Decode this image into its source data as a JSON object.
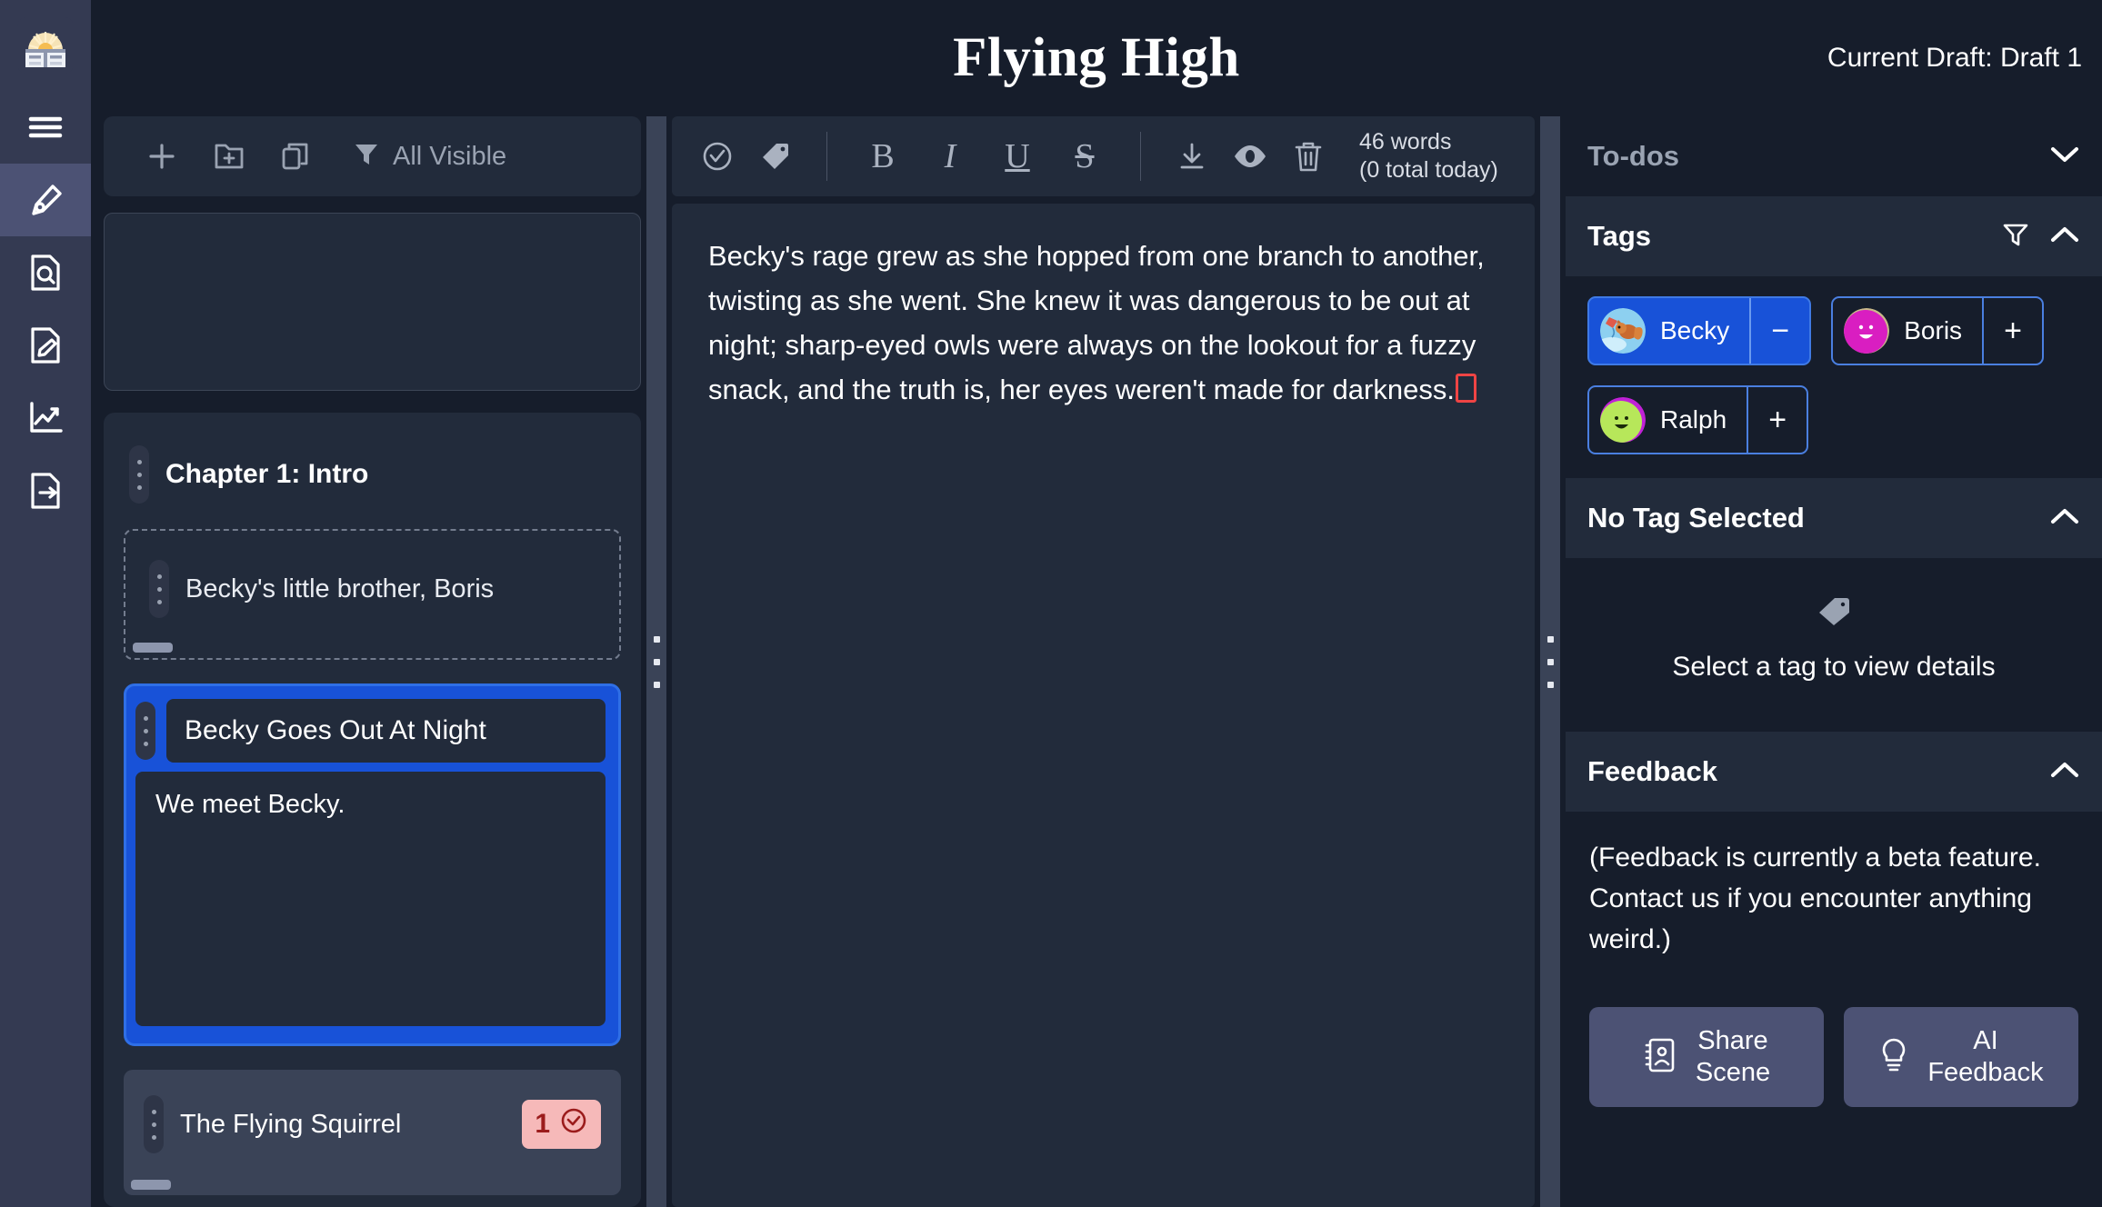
{
  "header": {
    "app_title": "Flying High",
    "draft_label": "Current Draft: Draft 1",
    "logo_icon": "sunrise-window-logo"
  },
  "rail": {
    "items": [
      {
        "icon": "hamburger-menu-icon",
        "name": "menu",
        "active": false
      },
      {
        "icon": "pen-nib-icon",
        "name": "write",
        "active": true
      },
      {
        "icon": "document-search-icon",
        "name": "research",
        "active": false
      },
      {
        "icon": "document-edit-icon",
        "name": "notes",
        "active": false
      },
      {
        "icon": "chart-line-icon",
        "name": "statistics",
        "active": false
      },
      {
        "icon": "document-export-icon",
        "name": "export",
        "active": false
      }
    ]
  },
  "scene_panel": {
    "toolbar": {
      "add_icon": "plus-icon",
      "add_folder_icon": "folder-plus-icon",
      "duplicate_icon": "copy-icon",
      "filter_icon": "filter-icon",
      "filter_label": "All Visible"
    },
    "chapter": {
      "title": "Chapter 1: Intro",
      "grip_icon": "drag-handle-icon"
    },
    "scenes": [
      {
        "name": "Becky's little brother, Boris",
        "state": "ghost",
        "summary": "",
        "todo_count": null
      },
      {
        "name": "Becky Goes Out At Night",
        "state": "selected",
        "summary": "We meet Becky.",
        "todo_count": null
      },
      {
        "name": "The Flying Squirrel",
        "state": "plain",
        "summary": "",
        "todo_count": "1"
      }
    ]
  },
  "editor": {
    "toolbar": {
      "todo_icon": "check-circle-icon",
      "tag_icon": "tag-icon",
      "bold_label": "B",
      "italic_label": "I",
      "underline_label": "U",
      "strike_label": "S",
      "download_icon": "download-icon",
      "eye_icon": "eye-icon",
      "trash_icon": "trash-icon",
      "word_count": "46 words",
      "word_count_sub": "(0 total today)"
    },
    "text": "Becky's rage grew as she hopped from one branch to another, twisting as she went. She knew it was dangerous to be out at night; sharp-eyed owls were always on the lookout for a fuzzy snack, and the truth is, her eyes weren't made for darkness."
  },
  "right_panel": {
    "todos": {
      "title": "To-dos",
      "chevron_icon": "chevron-down-icon"
    },
    "tags": {
      "title": "Tags",
      "filter_icon": "filter-icon",
      "chevron_icon": "chevron-up-icon",
      "items": [
        {
          "name": "Becky",
          "action": "−",
          "selected": true,
          "avatar": "squirrel-kite-avatar"
        },
        {
          "name": "Boris",
          "action": "+",
          "selected": false,
          "avatar": "magenta-smiley-avatar"
        },
        {
          "name": "Ralph",
          "action": "+",
          "selected": false,
          "avatar": "green-smiley-avatar"
        }
      ]
    },
    "tag_details": {
      "title": "No Tag Selected",
      "chevron_icon": "chevron-up-icon",
      "empty_icon": "tag-icon",
      "empty_message": "Select a tag to view details"
    },
    "feedback": {
      "title": "Feedback",
      "chevron_icon": "chevron-up-icon",
      "note": "(Feedback is currently a beta feature. Contact us if you encounter anything weird.)",
      "buttons": [
        {
          "label_line1": "Share",
          "label_line2": "Scene",
          "icon": "contact-card-icon"
        },
        {
          "label_line1": "AI",
          "label_line2": "Feedback",
          "icon": "lightbulb-icon"
        }
      ]
    }
  },
  "colors": {
    "accent_blue": "#1852d8",
    "rail_bg": "#343a52",
    "panel_bg": "#222b3b",
    "page_bg": "#161d2b",
    "badge_red_bg": "#f6b9b9",
    "badge_red_fg": "#9b1c1c",
    "caret_red": "#ef4444"
  }
}
